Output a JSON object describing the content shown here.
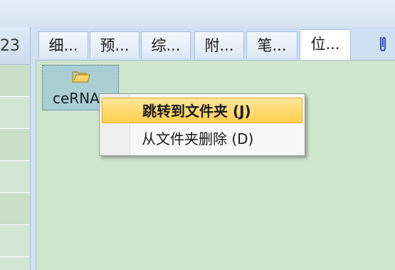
{
  "left_panel": {
    "header_text": "23"
  },
  "tabs": [
    {
      "label": "细..."
    },
    {
      "label": "预..."
    },
    {
      "label": "综..."
    },
    {
      "label": "附..."
    },
    {
      "label": "笔..."
    },
    {
      "label": "位..."
    }
  ],
  "active_tab_index": 5,
  "colors": {
    "content_bg": "#cde6cd",
    "selected_item_bg": "#a9cfd4",
    "menu_highlight": "#ffd862",
    "clip_icon": "#2a4fb8"
  },
  "content": {
    "folder_item": {
      "label": "ceRNA",
      "icon": "folder-open-icon"
    }
  },
  "context_menu": {
    "items": [
      {
        "label": "跳转到文件夹 (J)",
        "highlighted": true
      },
      {
        "label": "从文件夹删除 (D)",
        "highlighted": false
      }
    ]
  }
}
